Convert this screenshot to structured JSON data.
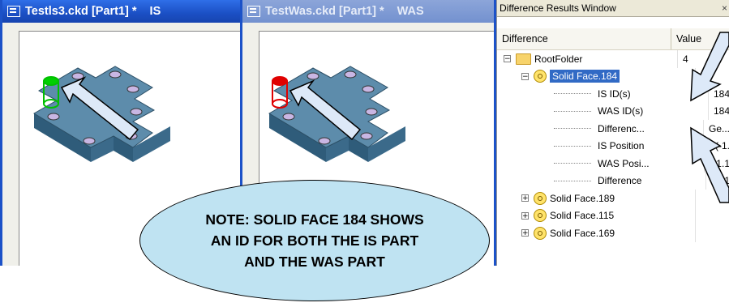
{
  "windows": [
    {
      "title": "Testls3.ckd [Part1] *",
      "suffix": "IS",
      "selected_marker_color": "#00c000"
    },
    {
      "title": "TestWas.ckd [Part1] *",
      "suffix": "WAS",
      "selected_marker_color": "#e00000"
    }
  ],
  "difference_window": {
    "title": "Difference Results Window",
    "close_glyph": "×",
    "columns": [
      "Difference",
      "Value"
    ],
    "rows": [
      {
        "label": "RootFolder",
        "value": "4",
        "type": "folder",
        "expander": "−"
      },
      {
        "label": "Solid Face.184",
        "value": "",
        "type": "face",
        "expander": "−",
        "selected": true
      },
      {
        "label": "IS  ID(s)",
        "value": "184",
        "type": "leaf"
      },
      {
        "label": "WAS  ID(s)",
        "value": "184",
        "type": "leaf"
      },
      {
        "label": "Differenc...",
        "value": "Ge...",
        "type": "leaf"
      },
      {
        "label": "IS  Position",
        "value": "(-1.",
        "type": "leaf"
      },
      {
        "label": "WAS  Posi...",
        "value": "(-1.1",
        "type": "leaf"
      },
      {
        "label": "Difference",
        "value": "0.01",
        "type": "leaf"
      },
      {
        "label": "Solid Face.189",
        "value": "",
        "type": "face",
        "expander": "+"
      },
      {
        "label": "Solid Face.115",
        "value": "",
        "type": "face",
        "expander": "+"
      },
      {
        "label": "Solid Face.169",
        "value": "",
        "type": "face",
        "expander": "+"
      }
    ]
  },
  "callout": {
    "lines": [
      "NOTE: SOLID FACE 184 SHOWS",
      "AN ID FOR BOTH THE IS PART",
      "AND THE WAS PART"
    ]
  },
  "colors": {
    "part_body": "#4f7f9e",
    "hole": "#c9b6e3",
    "arrow_fill": "#dde9f8",
    "callout_fill": "#bfe3f2"
  }
}
